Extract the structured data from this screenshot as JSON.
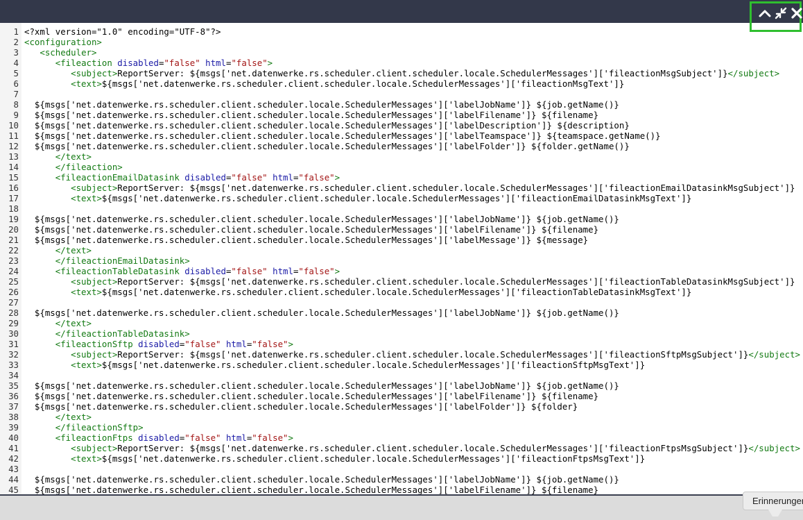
{
  "window": {
    "controls": [
      {
        "name": "collapse",
        "icon": "chevron-up-icon"
      },
      {
        "name": "minimize",
        "icon": "shrink-arrows-icon"
      },
      {
        "name": "close",
        "icon": "close-icon"
      }
    ],
    "highlight_color": "#2fbf2f",
    "titlebar_color": "#33384a"
  },
  "editor": {
    "language": "xml",
    "lines": [
      {
        "n": "1",
        "segs": [
          {
            "c": "code",
            "t": "<?xml version=\"1.0\" encoding=\"UTF-8\"?>"
          }
        ]
      },
      {
        "n": "2",
        "segs": [
          {
            "c": "tag",
            "t": "<configuration>"
          }
        ]
      },
      {
        "n": "3",
        "segs": [
          {
            "c": "code",
            "t": "   "
          },
          {
            "c": "tag",
            "t": "<scheduler>"
          }
        ]
      },
      {
        "n": "4",
        "segs": [
          {
            "c": "code",
            "t": "      "
          },
          {
            "c": "tag",
            "t": "<fileaction "
          },
          {
            "c": "attr",
            "t": "disabled"
          },
          {
            "c": "code",
            "t": "="
          },
          {
            "c": "str",
            "t": "\"false\""
          },
          {
            "c": "code",
            "t": " "
          },
          {
            "c": "attr",
            "t": "html"
          },
          {
            "c": "code",
            "t": "="
          },
          {
            "c": "str",
            "t": "\"false\""
          },
          {
            "c": "tag",
            "t": ">"
          }
        ]
      },
      {
        "n": "5",
        "segs": [
          {
            "c": "code",
            "t": "         "
          },
          {
            "c": "tag",
            "t": "<subject>"
          },
          {
            "c": "code",
            "t": "ReportServer: ${msgs['net.datenwerke.rs.scheduler.client.scheduler.locale.SchedulerMessages']['fileactionMsgSubject']}"
          },
          {
            "c": "tag",
            "t": "</subject>"
          }
        ]
      },
      {
        "n": "6",
        "segs": [
          {
            "c": "code",
            "t": "         "
          },
          {
            "c": "tag",
            "t": "<text>"
          },
          {
            "c": "code",
            "t": "${msgs['net.datenwerke.rs.scheduler.client.scheduler.locale.SchedulerMessages']['fileactionMsgText']}"
          }
        ]
      },
      {
        "n": "7",
        "segs": [
          {
            "c": "code",
            "t": ""
          }
        ]
      },
      {
        "n": "8",
        "segs": [
          {
            "c": "code",
            "t": "  ${msgs['net.datenwerke.rs.scheduler.client.scheduler.locale.SchedulerMessages']['labelJobName']} ${job.getName()}"
          }
        ]
      },
      {
        "n": "9",
        "segs": [
          {
            "c": "code",
            "t": "  ${msgs['net.datenwerke.rs.scheduler.client.scheduler.locale.SchedulerMessages']['labelFilename']} ${filename}"
          }
        ]
      },
      {
        "n": "10",
        "segs": [
          {
            "c": "code",
            "t": "  ${msgs['net.datenwerke.rs.scheduler.client.scheduler.locale.SchedulerMessages']['labelDescription']} ${description}"
          }
        ]
      },
      {
        "n": "11",
        "segs": [
          {
            "c": "code",
            "t": "  ${msgs['net.datenwerke.rs.scheduler.client.scheduler.locale.SchedulerMessages']['labelTeamspace']} ${teamspace.getName()}"
          }
        ]
      },
      {
        "n": "12",
        "segs": [
          {
            "c": "code",
            "t": "  ${msgs['net.datenwerke.rs.scheduler.client.scheduler.locale.SchedulerMessages']['labelFolder']} ${folder.getName()}"
          }
        ]
      },
      {
        "n": "13",
        "segs": [
          {
            "c": "code",
            "t": "      "
          },
          {
            "c": "tag",
            "t": "</text>"
          }
        ]
      },
      {
        "n": "14",
        "segs": [
          {
            "c": "code",
            "t": "      "
          },
          {
            "c": "tag",
            "t": "</fileaction>"
          }
        ]
      },
      {
        "n": "15",
        "segs": [
          {
            "c": "code",
            "t": "      "
          },
          {
            "c": "tag",
            "t": "<fileactionEmailDatasink "
          },
          {
            "c": "attr",
            "t": "disabled"
          },
          {
            "c": "code",
            "t": "="
          },
          {
            "c": "str",
            "t": "\"false\""
          },
          {
            "c": "code",
            "t": " "
          },
          {
            "c": "attr",
            "t": "html"
          },
          {
            "c": "code",
            "t": "="
          },
          {
            "c": "str",
            "t": "\"false\""
          },
          {
            "c": "tag",
            "t": ">"
          }
        ]
      },
      {
        "n": "16",
        "segs": [
          {
            "c": "code",
            "t": "         "
          },
          {
            "c": "tag",
            "t": "<subject>"
          },
          {
            "c": "code",
            "t": "ReportServer: ${msgs['net.datenwerke.rs.scheduler.client.scheduler.locale.SchedulerMessages']['fileactionEmailDatasinkMsgSubject']}"
          }
        ]
      },
      {
        "n": "17",
        "segs": [
          {
            "c": "code",
            "t": "         "
          },
          {
            "c": "tag",
            "t": "<text>"
          },
          {
            "c": "code",
            "t": "${msgs['net.datenwerke.rs.scheduler.client.scheduler.locale.SchedulerMessages']['fileactionEmailDatasinkMsgText']}"
          }
        ]
      },
      {
        "n": "18",
        "segs": [
          {
            "c": "code",
            "t": ""
          }
        ]
      },
      {
        "n": "19",
        "segs": [
          {
            "c": "code",
            "t": "  ${msgs['net.datenwerke.rs.scheduler.client.scheduler.locale.SchedulerMessages']['labelJobName']} ${job.getName()}"
          }
        ]
      },
      {
        "n": "20",
        "segs": [
          {
            "c": "code",
            "t": "  ${msgs['net.datenwerke.rs.scheduler.client.scheduler.locale.SchedulerMessages']['labelFilename']} ${filename}"
          }
        ]
      },
      {
        "n": "21",
        "segs": [
          {
            "c": "code",
            "t": "  ${msgs['net.datenwerke.rs.scheduler.client.scheduler.locale.SchedulerMessages']['labelMessage']} ${message}"
          }
        ]
      },
      {
        "n": "22",
        "segs": [
          {
            "c": "code",
            "t": "      "
          },
          {
            "c": "tag",
            "t": "</text>"
          }
        ]
      },
      {
        "n": "23",
        "segs": [
          {
            "c": "code",
            "t": "      "
          },
          {
            "c": "tag",
            "t": "</fileactionEmailDatasink>"
          }
        ]
      },
      {
        "n": "24",
        "segs": [
          {
            "c": "code",
            "t": "      "
          },
          {
            "c": "tag",
            "t": "<fileactionTableDatasink "
          },
          {
            "c": "attr",
            "t": "disabled"
          },
          {
            "c": "code",
            "t": "="
          },
          {
            "c": "str",
            "t": "\"false\""
          },
          {
            "c": "code",
            "t": " "
          },
          {
            "c": "attr",
            "t": "html"
          },
          {
            "c": "code",
            "t": "="
          },
          {
            "c": "str",
            "t": "\"false\""
          },
          {
            "c": "tag",
            "t": ">"
          }
        ]
      },
      {
        "n": "25",
        "segs": [
          {
            "c": "code",
            "t": "         "
          },
          {
            "c": "tag",
            "t": "<subject>"
          },
          {
            "c": "code",
            "t": "ReportServer: ${msgs['net.datenwerke.rs.scheduler.client.scheduler.locale.SchedulerMessages']['fileactionTableDatasinkMsgSubject']}"
          }
        ]
      },
      {
        "n": "26",
        "segs": [
          {
            "c": "code",
            "t": "         "
          },
          {
            "c": "tag",
            "t": "<text>"
          },
          {
            "c": "code",
            "t": "${msgs['net.datenwerke.rs.scheduler.client.scheduler.locale.SchedulerMessages']['fileactionTableDatasinkMsgText']}"
          }
        ]
      },
      {
        "n": "27",
        "segs": [
          {
            "c": "code",
            "t": ""
          }
        ]
      },
      {
        "n": "28",
        "segs": [
          {
            "c": "code",
            "t": "  ${msgs['net.datenwerke.rs.scheduler.client.scheduler.locale.SchedulerMessages']['labelJobName']} ${job.getName()}"
          }
        ]
      },
      {
        "n": "29",
        "segs": [
          {
            "c": "code",
            "t": "      "
          },
          {
            "c": "tag",
            "t": "</text>"
          }
        ]
      },
      {
        "n": "30",
        "segs": [
          {
            "c": "code",
            "t": "      "
          },
          {
            "c": "tag",
            "t": "</fileactionTableDatasink>"
          }
        ]
      },
      {
        "n": "31",
        "segs": [
          {
            "c": "code",
            "t": "      "
          },
          {
            "c": "tag",
            "t": "<fileactionSftp "
          },
          {
            "c": "attr",
            "t": "disabled"
          },
          {
            "c": "code",
            "t": "="
          },
          {
            "c": "str",
            "t": "\"false\""
          },
          {
            "c": "code",
            "t": " "
          },
          {
            "c": "attr",
            "t": "html"
          },
          {
            "c": "code",
            "t": "="
          },
          {
            "c": "str",
            "t": "\"false\""
          },
          {
            "c": "tag",
            "t": ">"
          }
        ]
      },
      {
        "n": "32",
        "segs": [
          {
            "c": "code",
            "t": "         "
          },
          {
            "c": "tag",
            "t": "<subject>"
          },
          {
            "c": "code",
            "t": "ReportServer: ${msgs['net.datenwerke.rs.scheduler.client.scheduler.locale.SchedulerMessages']['fileactionSftpMsgSubject']}"
          },
          {
            "c": "tag",
            "t": "</subject>"
          }
        ]
      },
      {
        "n": "33",
        "segs": [
          {
            "c": "code",
            "t": "         "
          },
          {
            "c": "tag",
            "t": "<text>"
          },
          {
            "c": "code",
            "t": "${msgs['net.datenwerke.rs.scheduler.client.scheduler.locale.SchedulerMessages']['fileactionSftpMsgText']}"
          }
        ]
      },
      {
        "n": "34",
        "segs": [
          {
            "c": "code",
            "t": ""
          }
        ]
      },
      {
        "n": "35",
        "segs": [
          {
            "c": "code",
            "t": "  ${msgs['net.datenwerke.rs.scheduler.client.scheduler.locale.SchedulerMessages']['labelJobName']} ${job.getName()}"
          }
        ]
      },
      {
        "n": "36",
        "segs": [
          {
            "c": "code",
            "t": "  ${msgs['net.datenwerke.rs.scheduler.client.scheduler.locale.SchedulerMessages']['labelFilename']} ${filename}"
          }
        ]
      },
      {
        "n": "37",
        "segs": [
          {
            "c": "code",
            "t": "  ${msgs['net.datenwerke.rs.scheduler.client.scheduler.locale.SchedulerMessages']['labelFolder']} ${folder}"
          }
        ]
      },
      {
        "n": "38",
        "segs": [
          {
            "c": "code",
            "t": "      "
          },
          {
            "c": "tag",
            "t": "</text>"
          }
        ]
      },
      {
        "n": "39",
        "segs": [
          {
            "c": "code",
            "t": "      "
          },
          {
            "c": "tag",
            "t": "</fileactionSftp>"
          }
        ]
      },
      {
        "n": "40",
        "segs": [
          {
            "c": "code",
            "t": "      "
          },
          {
            "c": "tag",
            "t": "<fileactionFtps "
          },
          {
            "c": "attr",
            "t": "disabled"
          },
          {
            "c": "code",
            "t": "="
          },
          {
            "c": "str",
            "t": "\"false\""
          },
          {
            "c": "code",
            "t": " "
          },
          {
            "c": "attr",
            "t": "html"
          },
          {
            "c": "code",
            "t": "="
          },
          {
            "c": "str",
            "t": "\"false\""
          },
          {
            "c": "tag",
            "t": ">"
          }
        ]
      },
      {
        "n": "41",
        "segs": [
          {
            "c": "code",
            "t": "         "
          },
          {
            "c": "tag",
            "t": "<subject>"
          },
          {
            "c": "code",
            "t": "ReportServer: ${msgs['net.datenwerke.rs.scheduler.client.scheduler.locale.SchedulerMessages']['fileactionFtpsMsgSubject']}"
          },
          {
            "c": "tag",
            "t": "</subject>"
          }
        ]
      },
      {
        "n": "42",
        "segs": [
          {
            "c": "code",
            "t": "         "
          },
          {
            "c": "tag",
            "t": "<text>"
          },
          {
            "c": "code",
            "t": "${msgs['net.datenwerke.rs.scheduler.client.scheduler.locale.SchedulerMessages']['fileactionFtpsMsgText']}"
          }
        ]
      },
      {
        "n": "43",
        "segs": [
          {
            "c": "code",
            "t": ""
          }
        ]
      },
      {
        "n": "44",
        "segs": [
          {
            "c": "code",
            "t": "  ${msgs['net.datenwerke.rs.scheduler.client.scheduler.locale.SchedulerMessages']['labelJobName']} ${job.getName()}"
          }
        ]
      },
      {
        "n": "45",
        "segs": [
          {
            "c": "code",
            "t": "  ${msgs['net.datenwerke.rs.scheduler.client.scheduler.locale.SchedulerMessages']['labelFilename']} ${filename}"
          }
        ]
      }
    ]
  },
  "reminder_button": {
    "label": "Erinnerungen"
  }
}
